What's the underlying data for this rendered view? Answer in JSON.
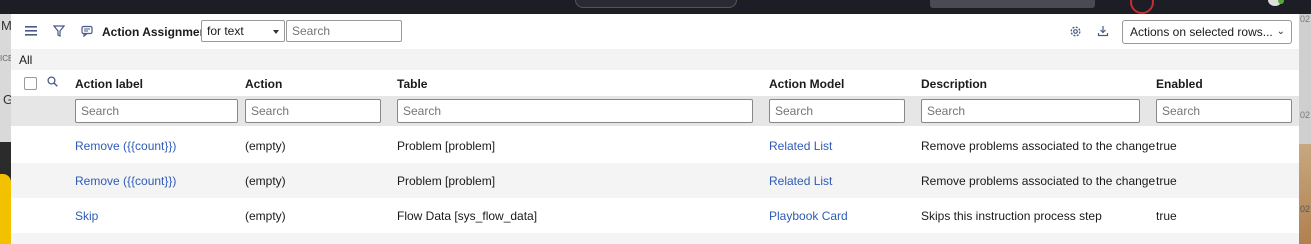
{
  "left_strip": [
    "M",
    "ICE",
    "G"
  ],
  "right_strip": [
    "02",
    "02",
    "02"
  ],
  "toolbar": {
    "title": "Action Assignments",
    "filter_field": "for text",
    "search_placeholder": "Search",
    "actions_select": "Actions on selected rows...",
    "icons": [
      "menu-icon",
      "filter-icon",
      "comment-icon",
      "gear-icon",
      "download-icon"
    ]
  },
  "breadcrumb": "All",
  "columns": [
    "Action label",
    "Action",
    "Table",
    "Action Model",
    "Description",
    "Enabled"
  ],
  "filter_placeholder": "Search",
  "rows": [
    {
      "label": "Remove ({{count}})",
      "action": "(empty)",
      "table": "Problem [problem]",
      "model": "Related List",
      "description": "Remove problems associated to the change",
      "enabled": "true"
    },
    {
      "label": "Remove ({{count}})",
      "action": "(empty)",
      "table": "Problem [problem]",
      "model": "Related List",
      "description": "Remove problems associated to the change",
      "enabled": "true"
    },
    {
      "label": "Skip",
      "action": "(empty)",
      "table": "Flow Data [sys_flow_data]",
      "model": "Playbook Card",
      "description": "Skips this instruction process step",
      "enabled": "true"
    }
  ],
  "colors": {
    "link": "#2f5bb7",
    "icon": "#4a5a8a",
    "topbar": "#1d1d26"
  }
}
